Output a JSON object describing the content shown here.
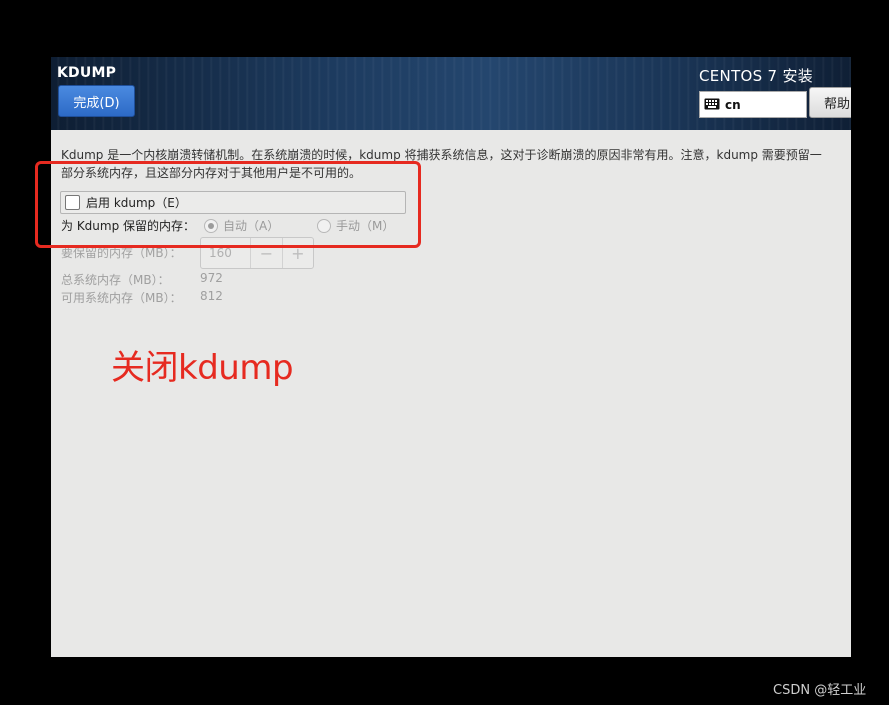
{
  "header": {
    "spoke_title": "KDUMP",
    "done_label": "完成(D)",
    "install_title": "CENTOS 7 安装",
    "keyboard_layout": "cn",
    "help_label": "帮助"
  },
  "content": {
    "description_line1": "Kdump 是一个内核崩溃转储机制。在系统崩溃的时候，kdump 将捕获系统信息，这对于诊断崩溃的原因非常有用。注意，kdump 需要预留一",
    "description_line2": "部分系统内存，且这部分内存对于其他用户是不可用的。",
    "enable_label": "启用 kdump（E）",
    "enable_checked": false,
    "reserve_mode_label": "为 Kdump 保留的内存：",
    "auto_label": "自动（A）",
    "manual_label": "手动（M）",
    "reserve_amount_label": "要保留的内存（MB）：",
    "reserve_amount_value": "160",
    "minus_label": "−",
    "plus_label": "+",
    "total_mem_label": "总系统内存（MB）：",
    "total_mem_value": "972",
    "usable_mem_label": "可用系统内存（MB）：",
    "usable_mem_value": "812"
  },
  "annotation": {
    "text": "关闭kdump",
    "color": "#e62a20"
  },
  "watermark": "CSDN @轻工业"
}
